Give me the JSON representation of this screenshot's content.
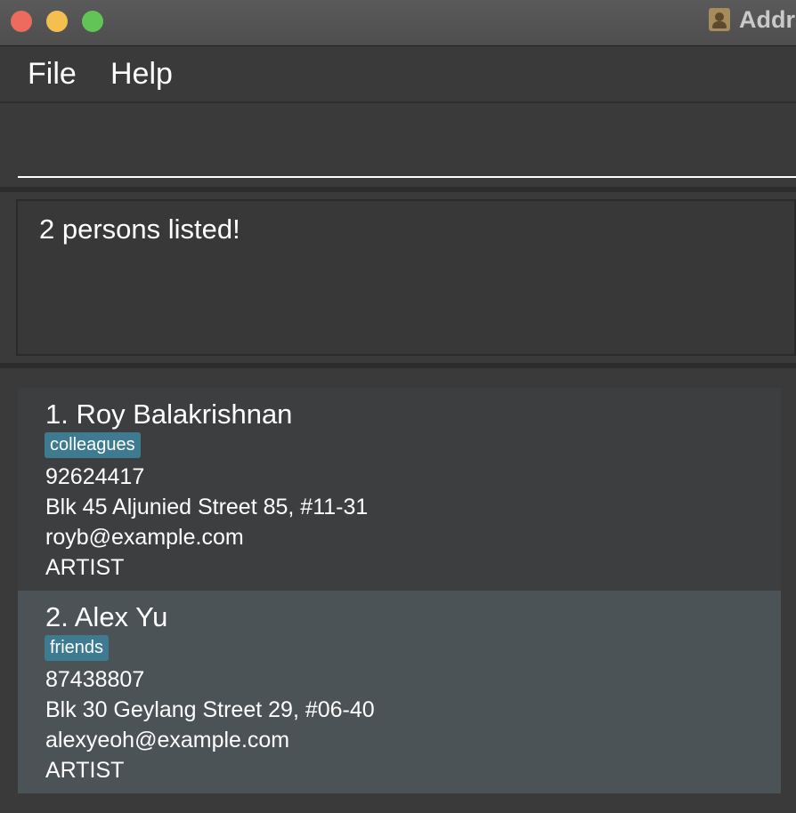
{
  "window": {
    "title": "Addr"
  },
  "menu": {
    "file_label": "File",
    "help_label": "Help"
  },
  "command": {
    "value": ""
  },
  "result": {
    "message": "2 persons listed!"
  },
  "persons": [
    {
      "index_name": "1. Roy Balakrishnan",
      "tag": "colleagues",
      "phone": "92624417",
      "address": "Blk 45 Aljunied Street 85, #11-31",
      "email": "royb@example.com",
      "job": "ARTIST"
    },
    {
      "index_name": "2. Alex Yu",
      "tag": "friends",
      "phone": "87438807",
      "address": "Blk 30 Geylang Street 29, #06-40",
      "email": "alexyeoh@example.com",
      "job": "ARTIST"
    }
  ],
  "colors": {
    "tag_background": "#3e7b91",
    "selected_card": "#4c5357",
    "close_button": "#ed6a5e",
    "minimize_button": "#f5bf4f",
    "maximize_button": "#61c454"
  },
  "icons": {
    "app": "address-book-icon"
  }
}
